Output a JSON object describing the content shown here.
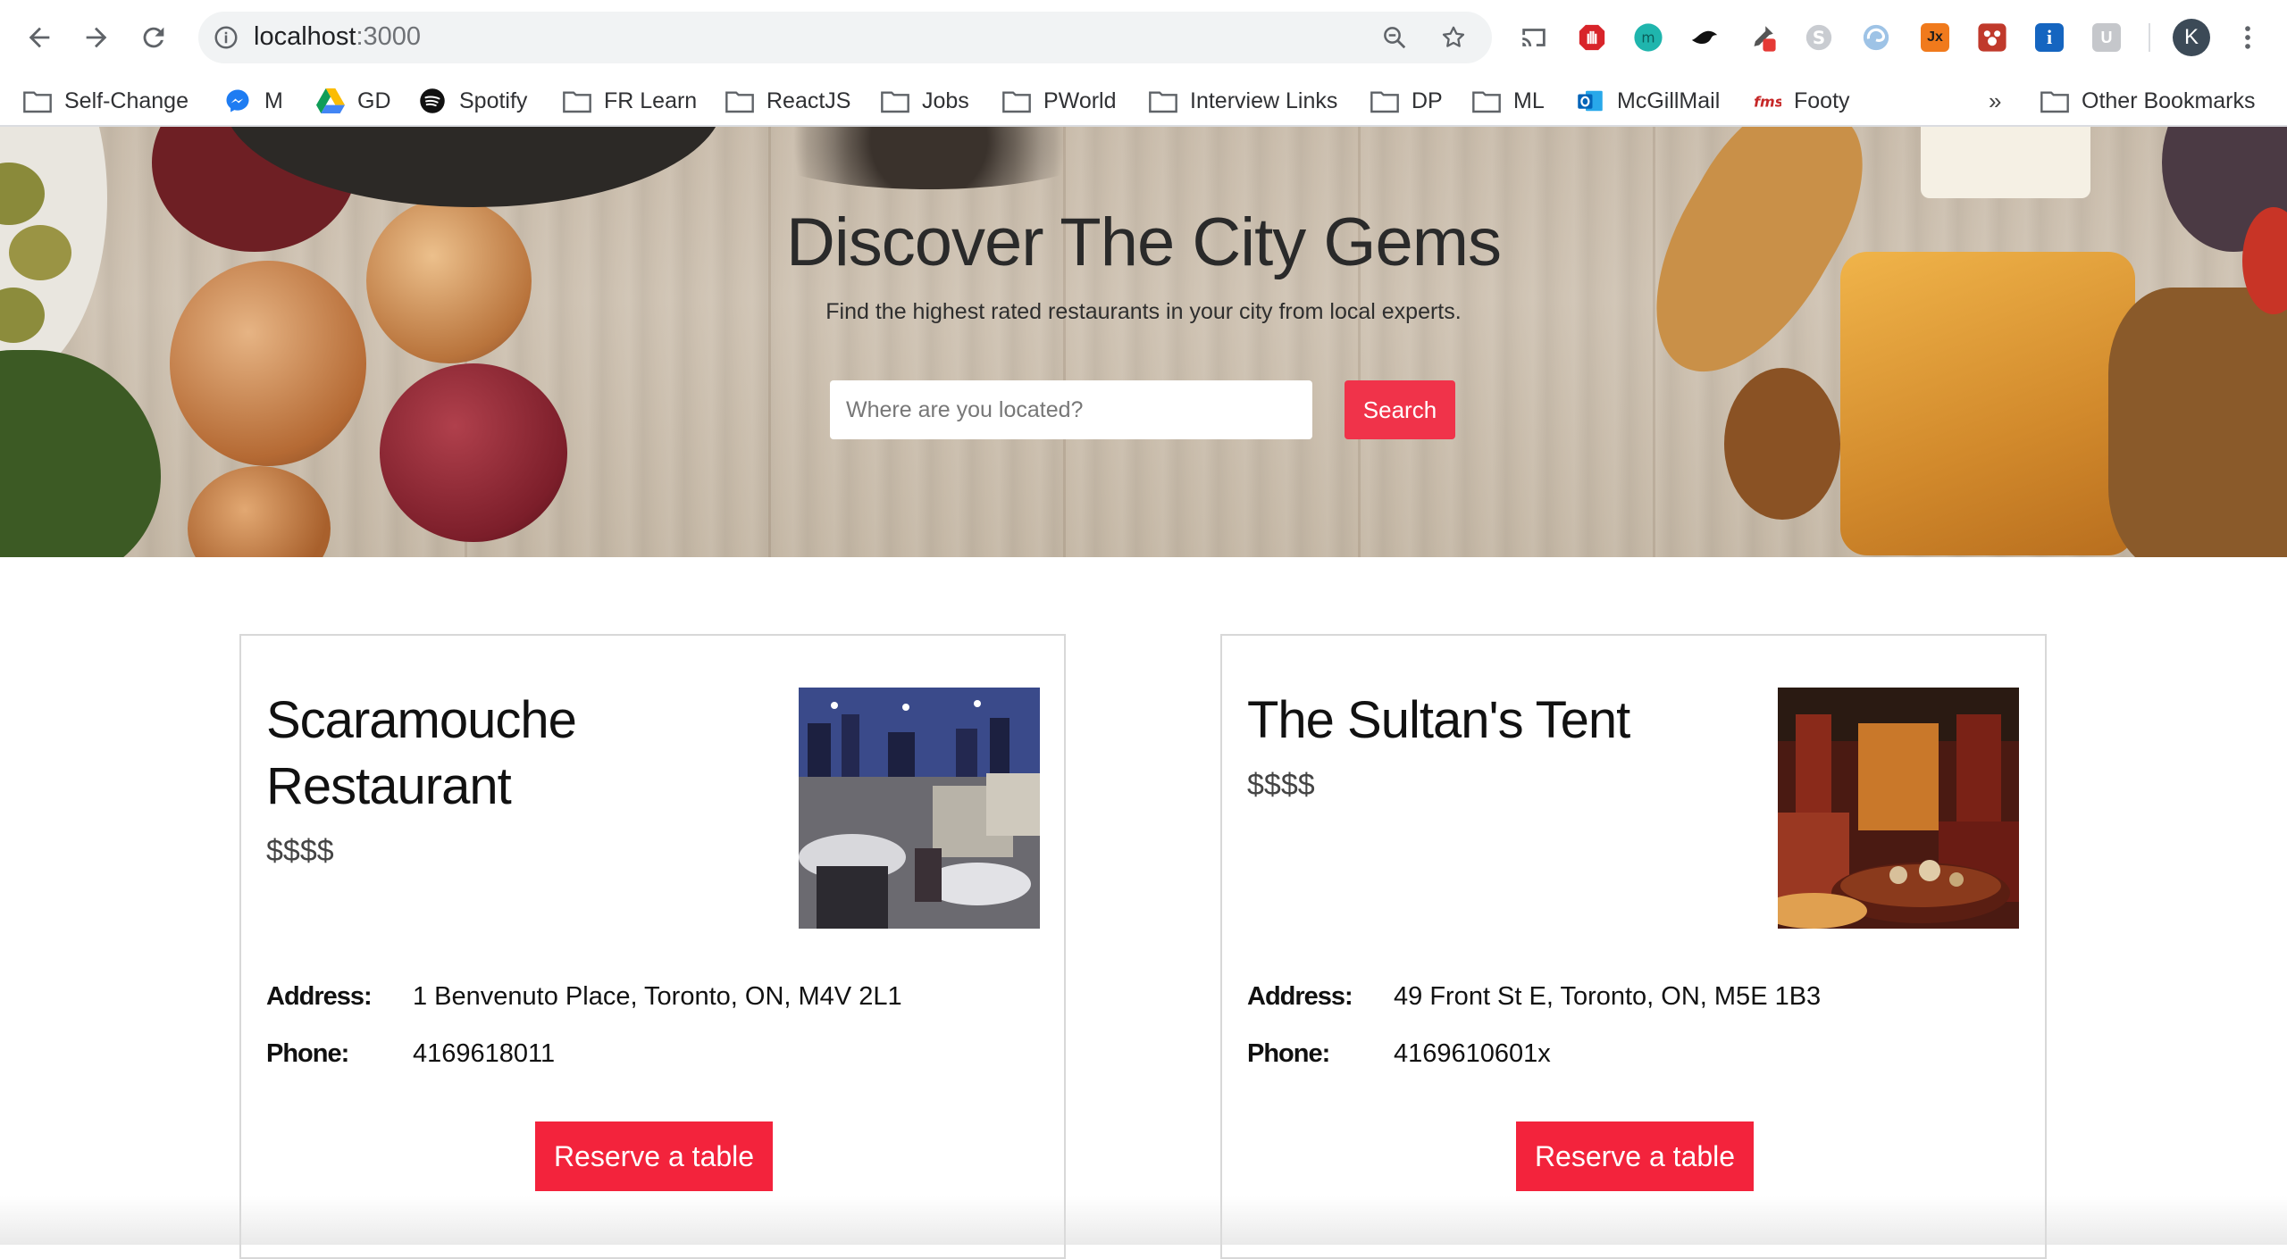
{
  "browser": {
    "url_host": "localhost",
    "url_port": ":3000",
    "avatar_letter": "K",
    "bookmarks": [
      {
        "label": "Self-Change",
        "icon": "folder-icon"
      },
      {
        "label": "M",
        "icon": "messenger-icon"
      },
      {
        "label": "GD",
        "icon": "google-drive-icon"
      },
      {
        "label": "Spotify",
        "icon": "spotify-icon"
      },
      {
        "label": "FR Learn",
        "icon": "folder-icon"
      },
      {
        "label": "ReactJS",
        "icon": "folder-icon"
      },
      {
        "label": "Jobs",
        "icon": "folder-icon"
      },
      {
        "label": "PWorld",
        "icon": "folder-icon"
      },
      {
        "label": "Interview Links",
        "icon": "folder-icon"
      },
      {
        "label": "DP",
        "icon": "folder-icon"
      },
      {
        "label": "ML",
        "icon": "folder-icon"
      },
      {
        "label": "McGillMail",
        "icon": "outlook-icon"
      },
      {
        "label": "Footy",
        "icon": "fms-icon"
      }
    ],
    "overflow_chevron": "»",
    "other_bookmarks": "Other Bookmarks",
    "extensions": {
      "jx": "Jx",
      "info": "i",
      "u": "U"
    }
  },
  "hero": {
    "title": "Discover The City Gems",
    "subtitle": "Find the highest rated restaurants in your city from local experts.",
    "search_placeholder": "Where are you located?",
    "search_button": "Search"
  },
  "restaurants": [
    {
      "name": "Scaramouche Restaurant",
      "price": "$$$$",
      "address_label": "Address:",
      "address": "1 Benvenuto Place, Toronto, ON, M4V 2L1",
      "phone_label": "Phone:",
      "phone": "4169618011",
      "button": "Reserve a table"
    },
    {
      "name": "The Sultan's Tent",
      "price": "$$$$",
      "address_label": "Address:",
      "address": "49 Front St E, Toronto, ON, M5E 1B3",
      "phone_label": "Phone:",
      "phone": "4169610601x",
      "button": "Reserve a table"
    }
  ],
  "colors": {
    "accent": "#f3233c",
    "search_button": "#f0334a"
  }
}
